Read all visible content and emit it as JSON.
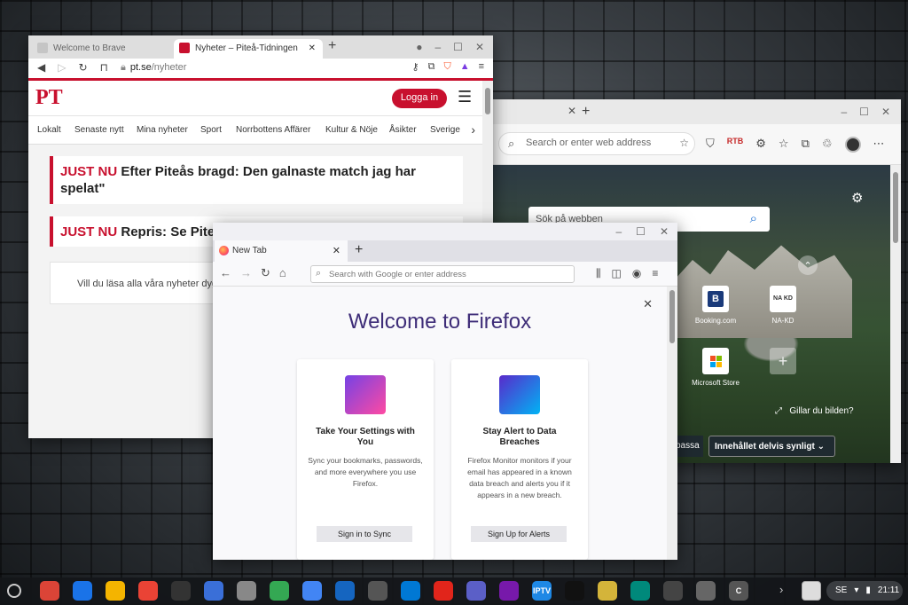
{
  "edge": {
    "address_placeholder": "Search or enter web address",
    "search_placeholder": "Sök på webben",
    "tiles": [
      {
        "letter": "B",
        "label": "Booking.com"
      },
      {
        "letter": "NA KD",
        "label": "NA-KD"
      },
      {
        "letter": "",
        "label": "Microsoft Store"
      }
    ],
    "like_text": "Gillar du bilden?",
    "btn_adjust": "passa",
    "btn_content": "Innehållet delvis synligt"
  },
  "brave": {
    "tab1_title": "Welcome to Brave",
    "tab2_title": "Nyheter – Piteå-Tidningen",
    "url_host": "pt.se",
    "url_path": "/nyheter",
    "logo": "PT",
    "login": "Logga in",
    "nav": [
      "Lokalt",
      "Senaste nytt",
      "Mina nyheter",
      "Sport",
      "Norrbottens Affärer",
      "Kultur & Nöje",
      "Åsikter",
      "Sverige"
    ],
    "headline1_tag": "JUST NU",
    "headline1": "Efter Piteås bragd: Den galnaste match jag har spelat\"",
    "headline2_tag": "JUST NU",
    "headline2": "Repris: Se Pite",
    "note": "Vill du läsa alla våra nyheter dyg"
  },
  "firefox": {
    "tab_title": "New Tab",
    "address_placeholder": "Search with Google or enter address",
    "heading": "Welcome to Firefox",
    "card1": {
      "title": "Take Your Settings with You",
      "desc": "Sync your bookmarks, passwords, and more everywhere you use Firefox.",
      "button": "Sign in to Sync"
    },
    "card2": {
      "title": "Stay Alert to Data Breaches",
      "desc": "Firefox Monitor monitors if your email has appeared in a known data breach and alerts you if it appears in a new breach.",
      "button": "Sign Up for Alerts"
    }
  },
  "shelf": {
    "apps": [
      {
        "name": "chrome",
        "color": "#db4437"
      },
      {
        "name": "files",
        "color": "#1a73e8"
      },
      {
        "name": "chrome-canary",
        "color": "#f4b400"
      },
      {
        "name": "gmail",
        "color": "#ea4335"
      },
      {
        "name": "terminal",
        "color": "#333333"
      },
      {
        "name": "tools",
        "color": "#3a6fd8"
      },
      {
        "name": "text",
        "color": "#888888"
      },
      {
        "name": "chat",
        "color": "#34a853"
      },
      {
        "name": "store",
        "color": "#4285f4"
      },
      {
        "name": "window",
        "color": "#1565c0"
      },
      {
        "name": "photos",
        "color": "#555555"
      },
      {
        "name": "outlook",
        "color": "#0078d4"
      },
      {
        "name": "acrobat",
        "color": "#e1251b"
      },
      {
        "name": "teams",
        "color": "#5b5fc7"
      },
      {
        "name": "onenote",
        "color": "#7719aa"
      },
      {
        "name": "iptv",
        "color": "#1e88e5",
        "label": "IPTV"
      },
      {
        "name": "triangle",
        "color": "#111111"
      },
      {
        "name": "yellow",
        "color": "#d4b43a"
      },
      {
        "name": "x",
        "color": "#00897b"
      },
      {
        "name": "cast",
        "color": "#444444"
      },
      {
        "name": "apple",
        "color": "#666666"
      },
      {
        "name": "c",
        "color": "#555555",
        "label": "C"
      }
    ],
    "ime": "SE",
    "time": "21:11"
  }
}
